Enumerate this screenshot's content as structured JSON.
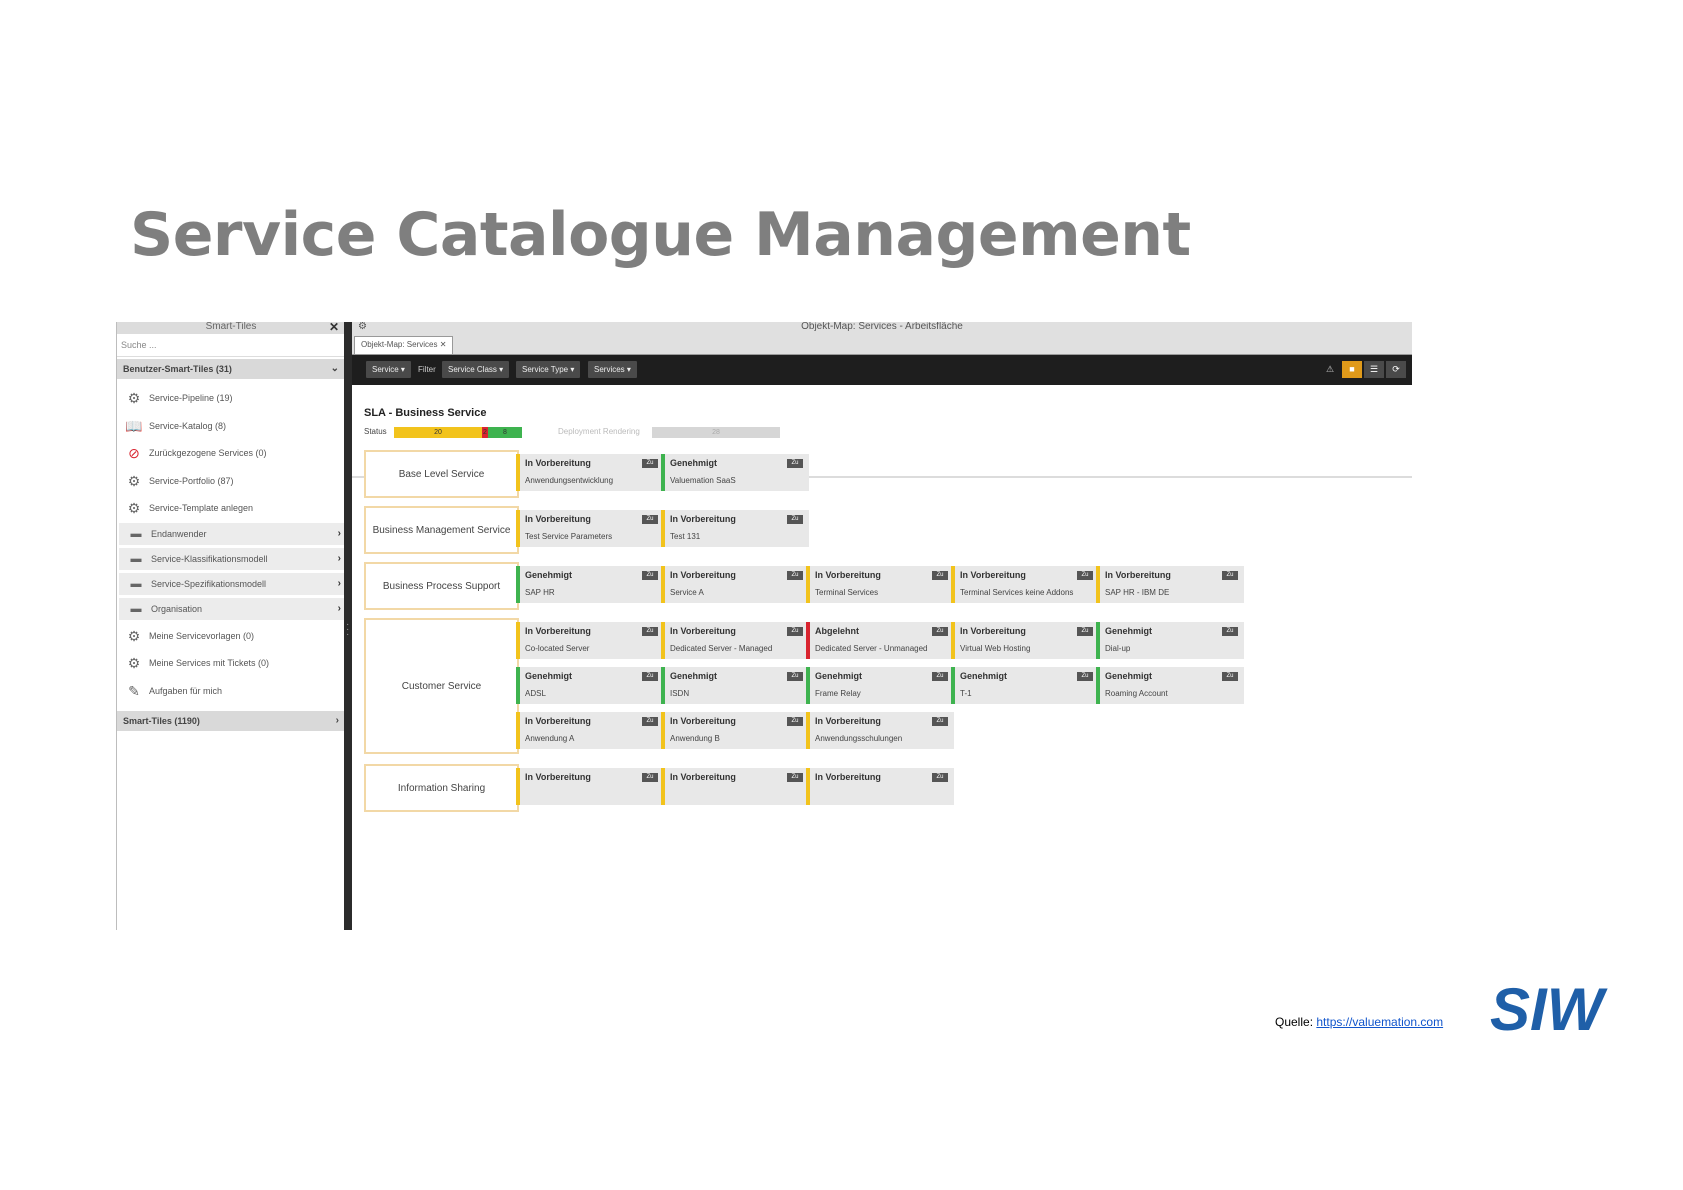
{
  "slide": {
    "title": "Service Catalogue Management",
    "source_label": "Quelle: ",
    "source_link": "https://valuemation.com",
    "logo_text": "SIW"
  },
  "left_panel": {
    "title": "Smart-Tiles",
    "search_placeholder": "Suche ...",
    "group_header": "Benutzer-Smart-Tiles (31)",
    "items": [
      {
        "label": "Service-Pipeline (19)",
        "icon": "pipeline-icon"
      },
      {
        "label": "Service-Katalog (8)",
        "icon": "catalog-icon"
      },
      {
        "label": "Zurückgezogene Services (0)",
        "icon": "forbidden-icon"
      },
      {
        "label": "Service-Portfolio (87)",
        "icon": "gears-icon"
      },
      {
        "label": "Service-Template anlegen",
        "icon": "gears-add-icon"
      }
    ],
    "folders": [
      {
        "label": "Endanwender"
      },
      {
        "label": "Service-Klassifikationsmodell"
      },
      {
        "label": "Service-Spezifikationsmodell"
      },
      {
        "label": "Organisation"
      }
    ],
    "items2": [
      {
        "label": "Meine Servicevorlagen (0)",
        "icon": "gears-icon"
      },
      {
        "label": "Meine Services mit Tickets (0)",
        "icon": "gears-icon"
      },
      {
        "label": "Aufgaben für mich",
        "icon": "tasks-icon"
      }
    ],
    "smart_tiles_header": "Smart-Tiles (1190)"
  },
  "right_panel": {
    "window_title": "Objekt-Map: Services - Arbeitsfläche",
    "tab_label": "Objekt-Map: Services",
    "toolbar": {
      "service_btn": "Service",
      "filter_label": "Filter",
      "service_class_btn": "Service Class",
      "service_type_btn": "Service Type",
      "services_btn": "Services"
    },
    "sla": {
      "title": "SLA - Business Service",
      "status_label": "Status",
      "bar_yellow": "20",
      "bar_red": "2",
      "bar_green": "8",
      "deployment_label": "Deployment Rendering",
      "deployment_value": "28"
    },
    "categories": [
      {
        "label": "Base Level Service"
      },
      {
        "label": "Business Management Service"
      },
      {
        "label": "Business Process Support"
      },
      {
        "label": "Customer Service"
      },
      {
        "label": "Information Sharing"
      }
    ],
    "zu_label": "Zu",
    "cards": [
      {
        "status": "In Vorbereitung",
        "name": "Anwendungsentwicklung",
        "color": "y"
      },
      {
        "status": "Genehmigt",
        "name": "Valuemation SaaS",
        "color": "g"
      },
      {
        "status": "In Vorbereitung",
        "name": "Test Service Parameters",
        "color": "y"
      },
      {
        "status": "In Vorbereitung",
        "name": "Test 131",
        "color": "y"
      },
      {
        "status": "Genehmigt",
        "name": "SAP HR",
        "color": "g"
      },
      {
        "status": "In Vorbereitung",
        "name": "Service A",
        "color": "y"
      },
      {
        "status": "In Vorbereitung",
        "name": "Terminal Services",
        "color": "y"
      },
      {
        "status": "In Vorbereitung",
        "name": "Terminal Services keine Addons",
        "color": "y"
      },
      {
        "status": "In Vorbereitung",
        "name": "SAP HR - IBM DE",
        "color": "y"
      },
      {
        "status": "In Vorbereitung",
        "name": "Co-located Server",
        "color": "y"
      },
      {
        "status": "In Vorbereitung",
        "name": "Dedicated Server - Managed",
        "color": "y"
      },
      {
        "status": "Abgelehnt",
        "name": "Dedicated Server - Unmanaged",
        "color": "r"
      },
      {
        "status": "In Vorbereitung",
        "name": "Virtual Web Hosting",
        "color": "y"
      },
      {
        "status": "Genehmigt",
        "name": "Dial-up",
        "color": "g"
      },
      {
        "status": "Genehmigt",
        "name": "ADSL",
        "color": "g"
      },
      {
        "status": "Genehmigt",
        "name": "ISDN",
        "color": "g"
      },
      {
        "status": "Genehmigt",
        "name": "Frame Relay",
        "color": "g"
      },
      {
        "status": "Genehmigt",
        "name": "T-1",
        "color": "g"
      },
      {
        "status": "Genehmigt",
        "name": "Roaming Account",
        "color": "g"
      },
      {
        "status": "In Vorbereitung",
        "name": "Anwendung A",
        "color": "y"
      },
      {
        "status": "In Vorbereitung",
        "name": "Anwendung B",
        "color": "y"
      },
      {
        "status": "In Vorbereitung",
        "name": "Anwendungsschulungen",
        "color": "y"
      },
      {
        "status": "In Vorbereitung",
        "name": "",
        "color": "y"
      },
      {
        "status": "In Vorbereitung",
        "name": "",
        "color": "y"
      },
      {
        "status": "In Vorbereitung",
        "name": "",
        "color": "y"
      }
    ]
  },
  "colors": {
    "title_gray": "#7f7f7f",
    "yellow": "#f2c31c",
    "green": "#3eb34f",
    "red": "#d9242f",
    "logo_blue": "#1f5fa8"
  }
}
